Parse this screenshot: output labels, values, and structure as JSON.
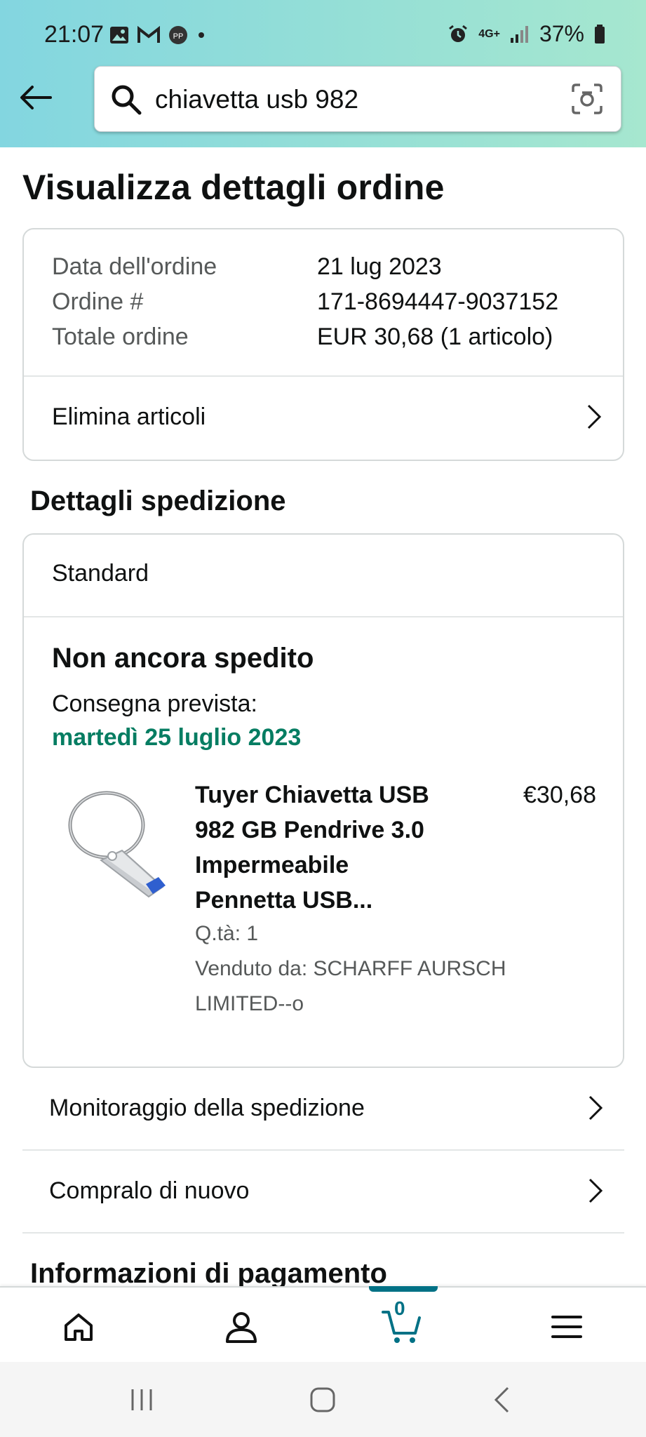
{
  "status_bar": {
    "time": "21:07",
    "network": "4G+",
    "battery": "37%"
  },
  "search": {
    "query": "chiavetta usb 982"
  },
  "page_title": "Visualizza dettagli ordine",
  "order_summary": {
    "rows": [
      {
        "label": "Data dell'ordine",
        "value": "21 lug 2023"
      },
      {
        "label": "Ordine #",
        "value": "171-8694447-9037152"
      },
      {
        "label": "Totale ordine",
        "value": "EUR 30,68 (1 articolo)"
      }
    ],
    "remove_items_label": "Elimina articoli"
  },
  "shipping": {
    "section_title": "Dettagli spedizione",
    "method": "Standard",
    "status": "Non ancora spedito",
    "delivery_label": "Consegna prevista:",
    "delivery_date": "martedì 25 luglio 2023",
    "delivery_date_color": "#067d62",
    "item": {
      "title_lines": [
        "Tuyer Chiavetta USB",
        "982 GB Pendrive 3.0",
        "Impermeabile",
        "Pennetta USB..."
      ],
      "price": "€30,68",
      "quantity": "Q.tà: 1",
      "seller_lines": [
        "Venduto da: SCHARFF AURSCH",
        "LIMITED--o"
      ]
    }
  },
  "links": {
    "track": "Monitoraggio della spedizione",
    "buy_again": "Compralo di nuovo"
  },
  "payment_section_title": "Informazioni di pagamento",
  "bottom_nav": {
    "items": [
      "home-icon",
      "account-icon",
      "cart-icon",
      "menu-icon"
    ],
    "cart_count": "0",
    "accent_color": "#007185"
  }
}
